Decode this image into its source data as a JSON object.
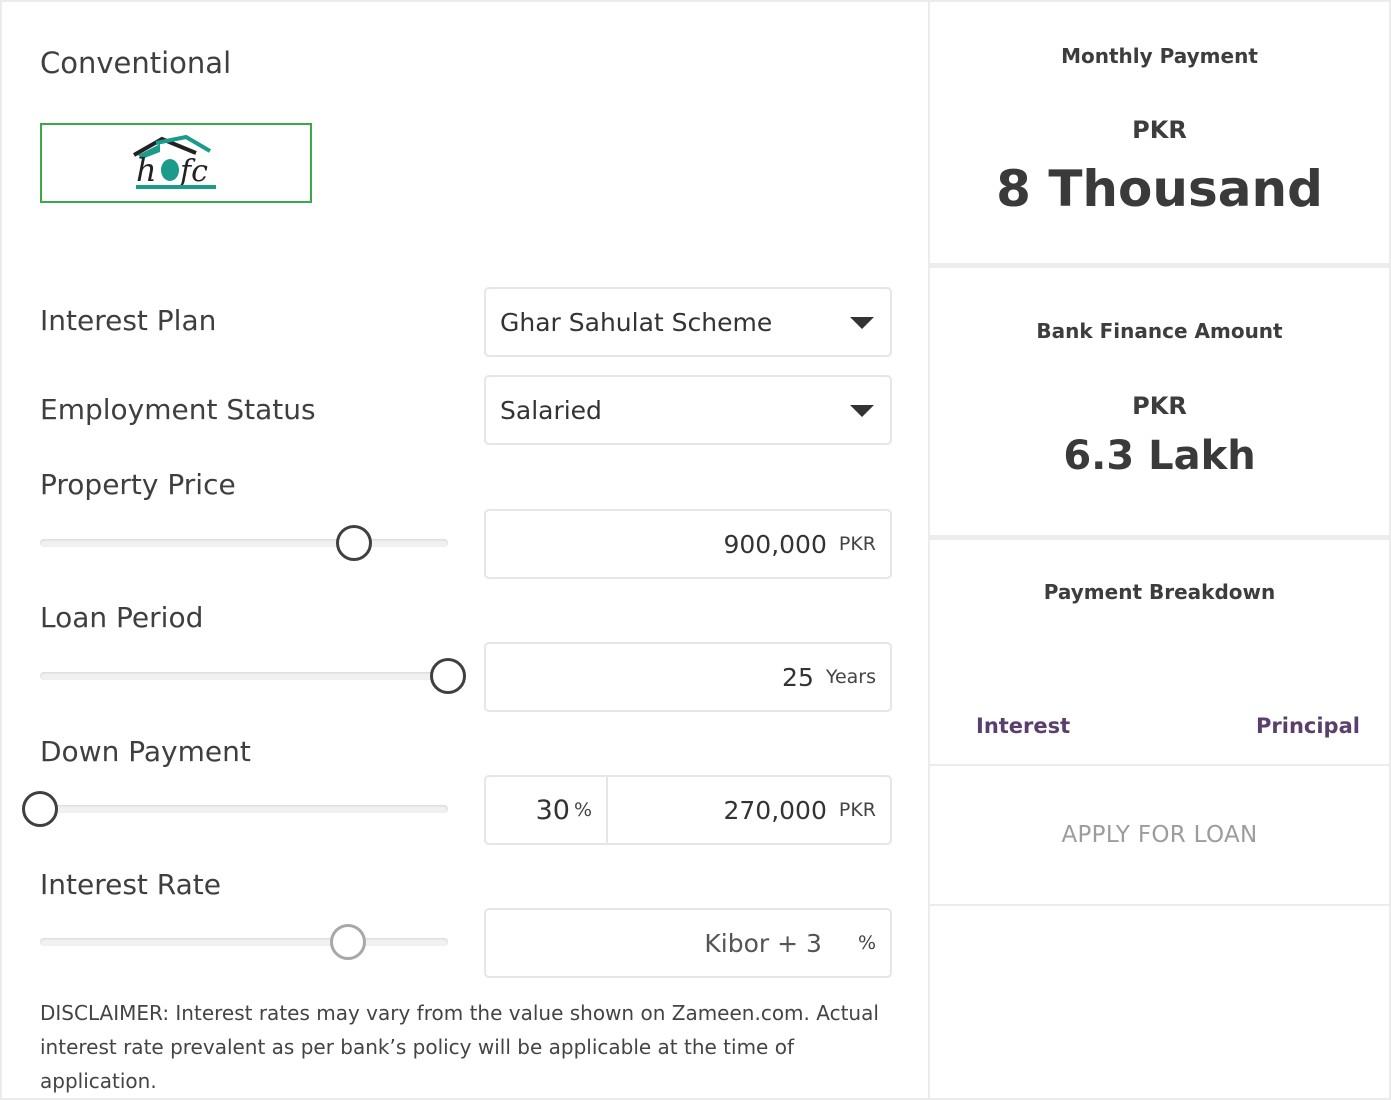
{
  "left": {
    "section_title": "Conventional",
    "logo_text": "hbfc",
    "interest_plan": {
      "label": "Interest Plan",
      "value": "Ghar Sahulat Scheme"
    },
    "employment_status": {
      "label": "Employment Status",
      "value": "Salaried"
    },
    "property_price": {
      "label": "Property Price",
      "value": "900,000",
      "unit": "PKR",
      "slider_fraction": 0.77
    },
    "loan_period": {
      "label": "Loan Period",
      "value": "25",
      "unit": "Years",
      "slider_fraction": 1.0
    },
    "down_payment": {
      "label": "Down Payment",
      "percent": "30",
      "percent_unit": "%",
      "value": "270,000",
      "unit": "PKR",
      "slider_fraction": 0.0
    },
    "interest_rate": {
      "label": "Interest Rate",
      "value": "Kibor + 3",
      "unit": "%",
      "slider_fraction": 0.755
    },
    "disclaimer": "DISCLAIMER: Interest rates may vary from the value shown on Zameen.com. Actual interest rate prevalent as per bank’s policy will be applicable at the time of application."
  },
  "right": {
    "monthly_payment": {
      "caption": "Monthly Payment",
      "currency": "PKR",
      "amount": "8 Thousand"
    },
    "bank_finance": {
      "caption": "Bank Finance Amount",
      "currency": "PKR",
      "amount": "6.3 Lakh"
    },
    "breakdown": {
      "caption": "Payment Breakdown",
      "legend_interest": "Interest",
      "legend_principal": "Principal"
    },
    "apply_label": "APPLY FOR LOAN"
  },
  "colors": {
    "logo_border": "#3aa94a",
    "legend_text": "#5b3e6b",
    "apply_text": "#9c9c9c"
  }
}
